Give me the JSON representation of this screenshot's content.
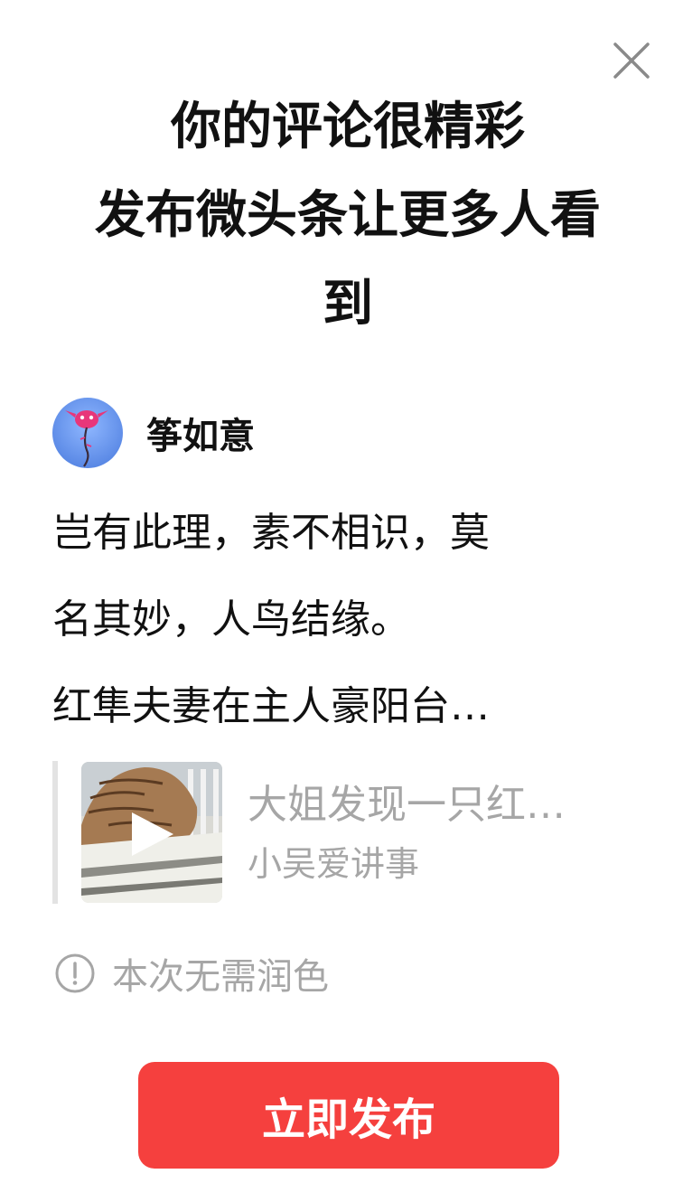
{
  "title": {
    "line1": "你的评论很精彩",
    "line2": "发布微头条让更多人看",
    "line3": "到"
  },
  "author": {
    "name": "筝如意",
    "avatar_icon": "kite-avatar-icon"
  },
  "comment": {
    "line1": "岂有此理，素不相识，莫",
    "line2": "名其妙，人鸟结缘。",
    "line3": "红隼夫妻在主人豪阳台…"
  },
  "quote": {
    "title": "大姐发现一只红…",
    "source": "小吴爱讲事",
    "thumb_icon": "play-icon"
  },
  "notice": {
    "icon": "info-icon",
    "text": "本次无需润色"
  },
  "publish_button": {
    "label": "立即发布"
  },
  "close_icon": "close-icon",
  "colors": {
    "accent": "#f5403e",
    "muted_text": "#a6a6a6",
    "main_text": "#111111"
  }
}
